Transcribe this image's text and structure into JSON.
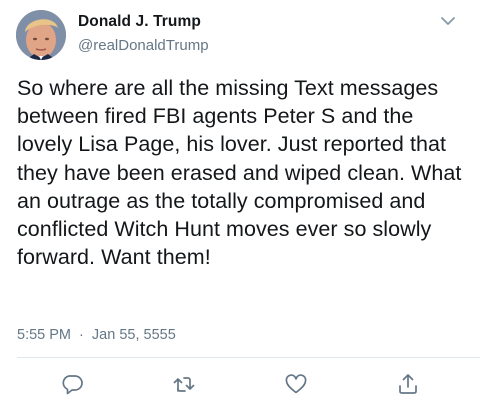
{
  "author": {
    "name": "Donald J. Trump",
    "handle": "@realDonaldTrump",
    "avatar_icon": "profile-photo"
  },
  "tweet": {
    "text": "So where are all the missing Text messages between fired FBI agents Peter S and the lovely Lisa Page, his lover. Just reported that they have been erased and wiped clean. What an outrage as the totally compromised and conflicted Witch Hunt moves ever so slowly forward. Want them!",
    "time": "5:55 PM",
    "separator": "·",
    "date": "Jan 55, 5555"
  },
  "actions": [
    {
      "name": "reply",
      "icon": "reply-icon"
    },
    {
      "name": "retweet",
      "icon": "retweet-icon"
    },
    {
      "name": "like",
      "icon": "heart-icon"
    },
    {
      "name": "share",
      "icon": "share-icon"
    }
  ],
  "colors": {
    "text": "#14171a",
    "secondary": "#657786",
    "divider": "#e1e8ed",
    "icon": "#657786"
  }
}
